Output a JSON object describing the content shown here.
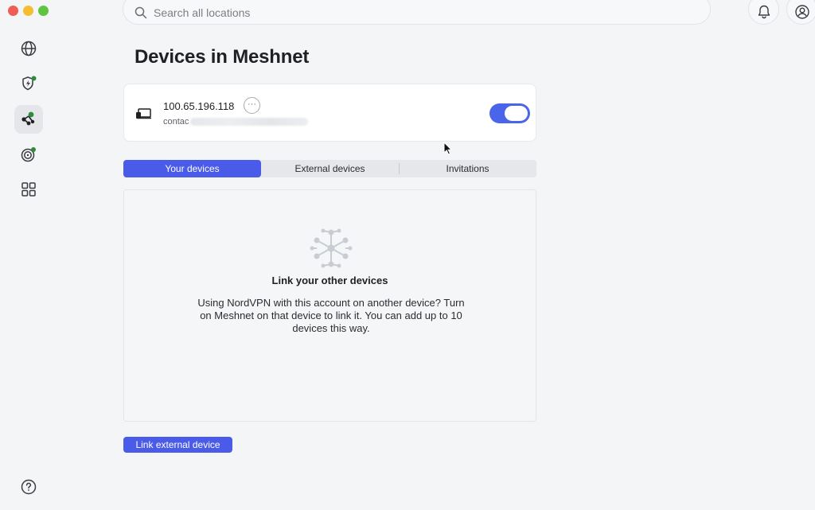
{
  "search": {
    "placeholder": "Search all locations"
  },
  "sidebar": {
    "items": [
      {
        "name": "globe-icon",
        "label": "Countries"
      },
      {
        "name": "shield-icon",
        "label": "Threat Protection"
      },
      {
        "name": "meshnet-icon",
        "label": "Meshnet",
        "active": true
      },
      {
        "name": "target-icon",
        "label": "Dark Web Monitor"
      },
      {
        "name": "apps-icon",
        "label": "Apps"
      },
      {
        "name": "help-icon",
        "label": "Help"
      }
    ]
  },
  "header": {
    "notifications_icon": "bell-icon",
    "account_icon": "user-icon"
  },
  "page": {
    "title": "Devices in Meshnet"
  },
  "this_device": {
    "ip": "100.65.196.118",
    "email_prefix": "contac",
    "more_label": "···",
    "toggle_on": true
  },
  "tabs": [
    {
      "label": "Your devices",
      "active": true
    },
    {
      "label": "External devices",
      "active": false
    },
    {
      "label": "Invitations",
      "active": false
    }
  ],
  "empty_state": {
    "title": "Link your other devices",
    "description": "Using NordVPN with this account on another device? Turn on Meshnet on that device to link it. You can add up to 10 devices this way."
  },
  "actions": {
    "link_external_label": "Link external device"
  },
  "colors": {
    "accent": "#4a5bea",
    "toggle": "#4a65ea",
    "badge_green": "#2e8b3d"
  }
}
